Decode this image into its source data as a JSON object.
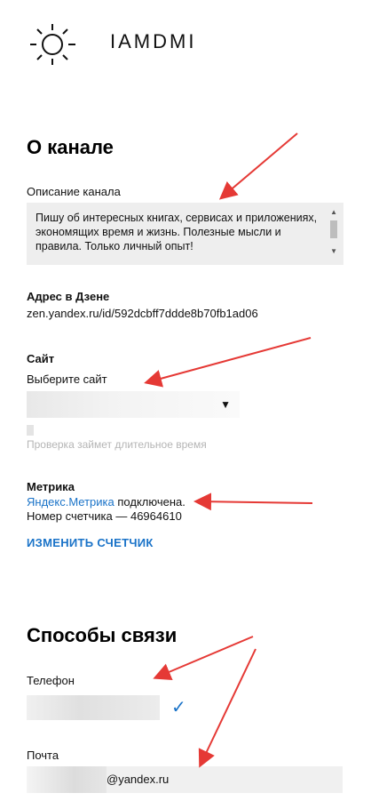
{
  "header": {
    "brand": "IAMDMI"
  },
  "about": {
    "title": "О канале",
    "description_label": "Описание канала",
    "description": "Пишу об интересных  книгах, сервисах и приложениях, экономящих время и жизнь. Полезные мысли и правила. Только личный опыт!"
  },
  "address": {
    "label": "Адрес в Дзене",
    "value": "zen.yandex.ru/id/592dcbff7ddde8b70fb1ad06"
  },
  "site": {
    "label": "Сайт",
    "select_label": "Выберите сайт",
    "hint": "Проверка займет длительное время"
  },
  "metrika": {
    "label": "Метрика",
    "link": "Яндекс.Метрика",
    "status": " подключена.",
    "counter": "Номер счетчика — 46964610",
    "action": "ИЗМЕНИТЬ СЧЕТЧИК"
  },
  "contacts": {
    "title": "Способы связи",
    "phone_label": "Телефон",
    "email_label": "Почта",
    "email_domain": "@yandex.ru"
  },
  "colors": {
    "accent": "#1a73c8",
    "arrow": "#e53935",
    "field_bg": "#eeeeee"
  }
}
